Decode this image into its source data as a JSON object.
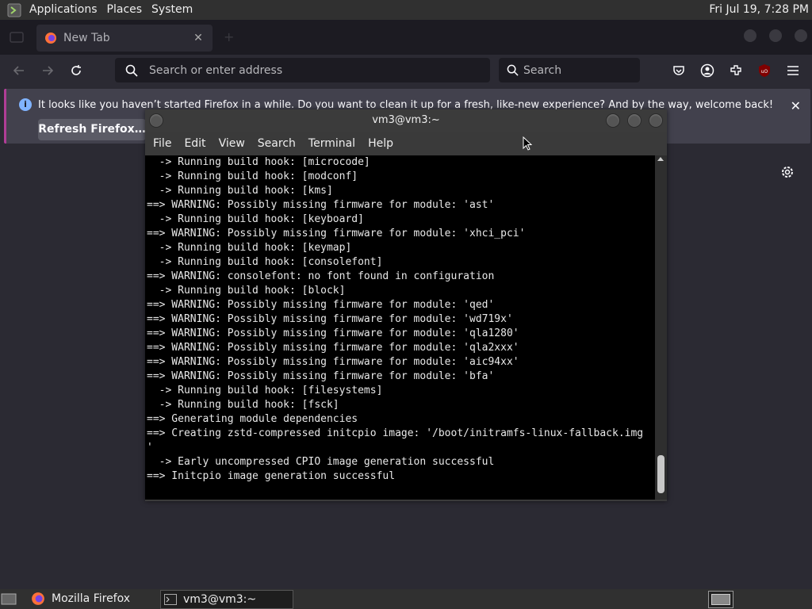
{
  "top_panel": {
    "menus": [
      "Applications",
      "Places",
      "System"
    ],
    "clock": "Fri Jul 19,  7:28 PM"
  },
  "firefox": {
    "tab_title": "New Tab",
    "url_placeholder": "Search or enter address",
    "search_placeholder": "Search",
    "notification": {
      "text": "It looks like you haven’t started Firefox in a while. Do you want to clean it up for a fresh, like-new experience? And by the way, welcome back!",
      "button": "Refresh Firefox…"
    }
  },
  "terminal": {
    "title": "vm3@vm3:~",
    "menus": [
      "File",
      "Edit",
      "View",
      "Search",
      "Terminal",
      "Help"
    ],
    "lines": [
      "  -> Running build hook: [microcode]",
      "  -> Running build hook: [modconf]",
      "  -> Running build hook: [kms]",
      "==> WARNING: Possibly missing firmware for module: 'ast'",
      "  -> Running build hook: [keyboard]",
      "==> WARNING: Possibly missing firmware for module: 'xhci_pci'",
      "  -> Running build hook: [keymap]",
      "  -> Running build hook: [consolefont]",
      "==> WARNING: consolefont: no font found in configuration",
      "  -> Running build hook: [block]",
      "==> WARNING: Possibly missing firmware for module: 'qed'",
      "==> WARNING: Possibly missing firmware for module: 'wd719x'",
      "==> WARNING: Possibly missing firmware for module: 'qla1280'",
      "==> WARNING: Possibly missing firmware for module: 'qla2xxx'",
      "==> WARNING: Possibly missing firmware for module: 'aic94xx'",
      "==> WARNING: Possibly missing firmware for module: 'bfa'",
      "  -> Running build hook: [filesystems]",
      "  -> Running build hook: [fsck]",
      "==> Generating module dependencies",
      "==> Creating zstd-compressed initcpio image: '/boot/initramfs-linux-fallback.img",
      "'",
      "  -> Early uncompressed CPIO image generation successful",
      "==> Initcpio image generation successful"
    ]
  },
  "taskbar": {
    "items": [
      "Mozilla Firefox",
      "vm3@vm3:~"
    ]
  },
  "colors": {
    "accent_notification": "#b03d96",
    "firefox_bg": "#2b2a33",
    "terminal_bg": "#000000",
    "panel_bg": "#303030"
  }
}
